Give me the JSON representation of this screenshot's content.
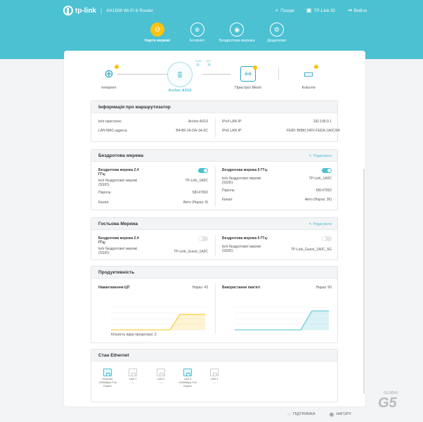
{
  "header": {
    "brand": "tp-link",
    "model": "AX1500 Wi-Fi 6 Router",
    "links": [
      {
        "label": "Пошук",
        "icon": "search-icon"
      },
      {
        "label": "TP-Link ID",
        "icon": "user-id-icon"
      },
      {
        "label": "Вийти",
        "icon": "logout-icon"
      }
    ]
  },
  "nav": [
    {
      "label": "Карта мережі",
      "icon": "network-map-icon",
      "active": true
    },
    {
      "label": "Інтернет",
      "icon": "globe-icon"
    },
    {
      "label": "Бездротова мережа",
      "icon": "wifi-icon"
    },
    {
      "label": "Додатково",
      "icon": "gear-icon"
    }
  ],
  "topology": {
    "internet": "Інтернет",
    "router": "Archer AX10",
    "band_24": "2.4G",
    "band_5": "5G",
    "mesh": "Пристрої Mesh",
    "clients": "Клієнти"
  },
  "router_info": {
    "title": "Інформація про маршрутизатор",
    "left": [
      {
        "k": "Ім'я пристрою:",
        "v": "Archer AX10"
      },
      {
        "k": "LAN MAC-адреса:",
        "v": "B4-B0-24-DA-1A-0C"
      }
    ],
    "right": [
      {
        "k": "IPv4 LAN IP:",
        "v": "192.168.0.1"
      },
      {
        "k": "IPv6 LAN IP:",
        "v": "FE80::B6B0:24FF:FEDA:1A0C/64"
      }
    ]
  },
  "wireless": {
    "title": "Бездротова мережа",
    "edit": "Редагувати",
    "left": {
      "name": "Бездротова мережа 2.4 ГГц:",
      "enabled": true,
      "rows": [
        {
          "k": "Ім'я бездротової мережі (SSID):",
          "v": "TP-Link_1A0C"
        },
        {
          "k": "Пароль:",
          "v": "58147092"
        },
        {
          "k": "Канал:",
          "v": "Авто (Нараз: 4)"
        }
      ]
    },
    "right": {
      "name": "Бездротова мережа 5 ГГц:",
      "enabled": true,
      "rows": [
        {
          "k": "Ім'я бездротової мережі (SSID):",
          "v": "TP-Link_1A0C"
        },
        {
          "k": "Пароль:",
          "v": "58147092"
        },
        {
          "k": "Канал:",
          "v": "Авто (Нараз: 36)"
        }
      ]
    }
  },
  "guest": {
    "title": "Гостьова Мережа",
    "edit": "Редагувати",
    "left": {
      "name": "Бездротова мережа 2.4 ГГц:",
      "enabled": false,
      "rows": [
        {
          "k": "Ім'я бездротової мережі (SSID):",
          "v": "TP-Link_Guest_1A0C"
        }
      ]
    },
    "right": {
      "name": "Бездротова мережа 5 ГГц:",
      "enabled": false,
      "rows": [
        {
          "k": "Ім'я бездротової мережі (SSID):",
          "v": "TP-Link_Guest_1A0C_5G"
        }
      ]
    }
  },
  "performance": {
    "title": "Продуктивність",
    "cpu_label": "Навантаження ЦП",
    "cpu_now": "Нараз: 43",
    "mem_label": "Використання пам'яті",
    "mem_now": "Нараз: 50",
    "cores": "Кількість ядер процесора: 3",
    "colors": {
      "cpu": "#fcc30f",
      "mem": "#4bc1d2"
    }
  },
  "ethernet": {
    "title": "Стан Ethernet",
    "ports": [
      {
        "name": "Інтернет",
        "speed": "1000Mbps Full Duplex",
        "on": true
      },
      {
        "name": "LAN 1",
        "speed": "---",
        "on": false
      },
      {
        "name": "LAN 2",
        "speed": "---",
        "on": false
      },
      {
        "name": "LAN 3",
        "speed": "1000Mbps Full Duplex",
        "on": true
      },
      {
        "name": "LAN 4",
        "speed": "---",
        "on": false
      }
    ]
  },
  "footer": {
    "support": "ПІДТРИМКА",
    "top": "НАГОРУ"
  },
  "watermark": "GLOBAL"
}
